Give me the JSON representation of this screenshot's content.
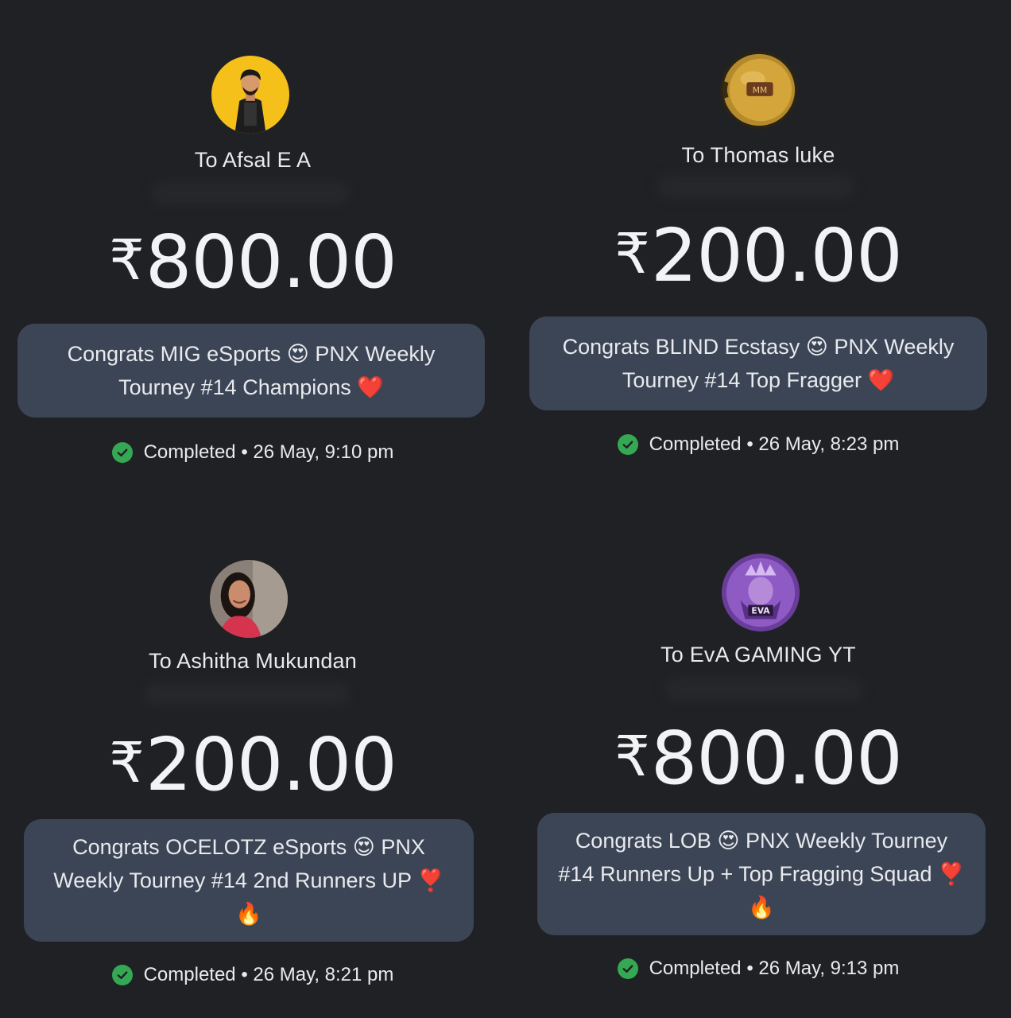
{
  "status_color": "#34a853",
  "transactions": [
    {
      "recipient": "To Afsal E A",
      "currency_symbol": "₹",
      "amount": "800.00",
      "note": "Congrats MIG eSports 😍 PNX Weekly Tourney #14 Champions ❤️",
      "status": "Completed",
      "separator": "•",
      "datetime": "26 May, 9:10 pm",
      "avatar_icon": "cartoon-man-avatar"
    },
    {
      "recipient": "To Thomas luke",
      "currency_symbol": "₹",
      "amount": "200.00",
      "note": "Congrats BLIND Ecstasy 😍 PNX Weekly Tourney #14 Top Fragger ❤️",
      "status": "Completed",
      "separator": "•",
      "datetime": "26 May, 8:23 pm",
      "avatar_icon": "gold-coin-avatar"
    },
    {
      "recipient": "To Ashitha Mukundan",
      "currency_symbol": "₹",
      "amount": "200.00",
      "note": "Congrats OCELOTZ eSports 😍 PNX Weekly Tourney #14 2nd Runners UP ❣️ 🔥",
      "status": "Completed",
      "separator": "•",
      "datetime": "26 May, 8:21 pm",
      "avatar_icon": "woman-photo-avatar"
    },
    {
      "recipient": "To EvA GAMING YT",
      "currency_symbol": "₹",
      "amount": "800.00",
      "note": "Congrats LOB 😍 PNX Weekly Tourney #14 Runners Up + Top Fragging Squad ❣️🔥",
      "status": "Completed",
      "separator": "•",
      "datetime": "26 May, 9:13 pm",
      "avatar_icon": "eva-gaming-logo-avatar"
    }
  ]
}
